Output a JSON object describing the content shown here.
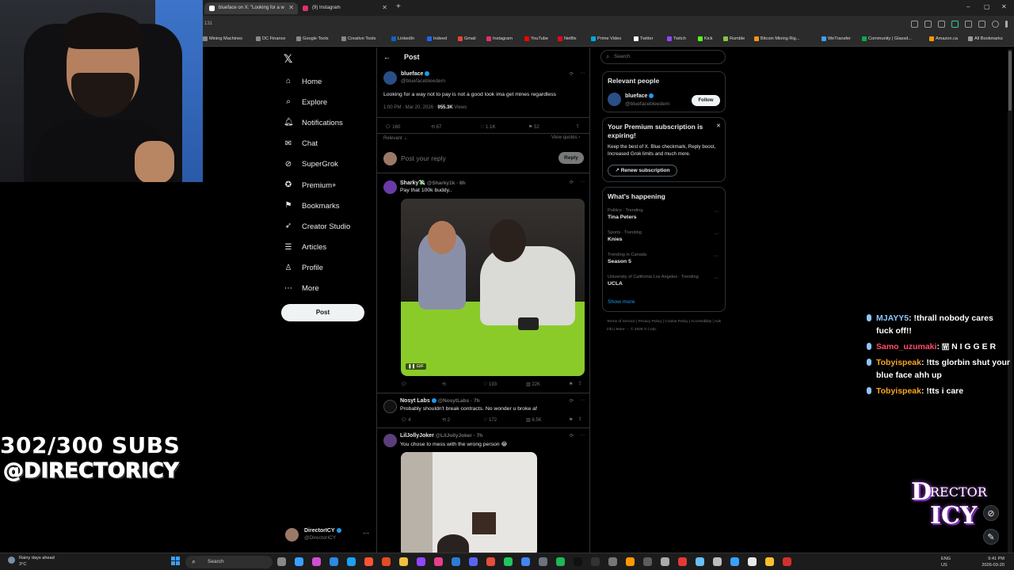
{
  "browser": {
    "tabs": [
      {
        "label": "blueface on X: \"Looking for a w",
        "color": "#ffffff",
        "active": true
      },
      {
        "label": "(9) Instagram",
        "color": "#e1306c",
        "active": false
      }
    ],
    "new_tab": "+",
    "window_controls": [
      "–",
      "▢",
      "✕"
    ],
    "address_fragment": "131",
    "bookmarks": [
      {
        "label": "Mining Machines",
        "color": "#888"
      },
      {
        "label": "DC Finance",
        "color": "#888"
      },
      {
        "label": "Google Tools",
        "color": "#888"
      },
      {
        "label": "Creative Tools",
        "color": "#888"
      },
      {
        "label": "LinkedIn",
        "color": "#0a66c2"
      },
      {
        "label": "Indeed",
        "color": "#2164f3"
      },
      {
        "label": "Gmail",
        "color": "#ea4335"
      },
      {
        "label": "Instagram",
        "color": "#e1306c"
      },
      {
        "label": "YouTube",
        "color": "#ff0000"
      },
      {
        "label": "Netflix",
        "color": "#e50914"
      },
      {
        "label": "Prime Video",
        "color": "#00a8e1"
      },
      {
        "label": "Twitter",
        "color": "#ffffff"
      },
      {
        "label": "Twitch",
        "color": "#9146ff"
      },
      {
        "label": "Kick",
        "color": "#53fc18"
      },
      {
        "label": "Rumble",
        "color": "#85c742"
      },
      {
        "label": "Bitcoin Mining Rig...",
        "color": "#f7931a"
      },
      {
        "label": "WeTransfer",
        "color": "#409fff"
      },
      {
        "label": "Community | Glassd...",
        "color": "#0caa41"
      },
      {
        "label": "Amazon.ca",
        "color": "#ff9900"
      }
    ],
    "all_bookmarks": "All Bookmarks"
  },
  "overlay": {
    "subs": "302/300 SUBS",
    "handle": "@DIRECTORICY",
    "logo_text": "DIRECTOR ICY",
    "chat": [
      {
        "user": "MJAYY5",
        "user_color": "#8ec5ff",
        "message": ": !thrall nobody cares fuck off!!"
      },
      {
        "user": "Samo_uzumaki",
        "user_color": "#ff4d6d",
        "message": ": 🇼 N I G G E R"
      },
      {
        "user": "Tobyispeak",
        "user_color": "#f6a623",
        "message": ": !tts glorbin shut your blue face ahh up"
      },
      {
        "user": "Tobyispeak",
        "user_color": "#f6a623",
        "message": ": !tts i care"
      }
    ]
  },
  "nav": {
    "logo": "𝕏",
    "items": [
      {
        "label": "Home",
        "icon": "⌂"
      },
      {
        "label": "Explore",
        "icon": "⌕"
      },
      {
        "label": "Notifications",
        "icon": "🔔︎"
      },
      {
        "label": "Chat",
        "icon": "✉"
      },
      {
        "label": "SuperGrok",
        "icon": "⊘"
      },
      {
        "label": "Premium+",
        "icon": "✪"
      },
      {
        "label": "Bookmarks",
        "icon": "⚑"
      },
      {
        "label": "Creator Studio",
        "icon": "➶"
      },
      {
        "label": "Articles",
        "icon": "☰"
      },
      {
        "label": "Profile",
        "icon": "♙"
      },
      {
        "label": "More",
        "icon": "⋯"
      }
    ],
    "post_button": "Post",
    "account": {
      "name": "DirectorICY",
      "handle": "@DirectorICY",
      "more": "···"
    }
  },
  "main": {
    "back": "←",
    "title": "Post",
    "post": {
      "name": "blueface",
      "handle": "@bluefacebleedem",
      "text": "Looking for a way not to pay is not a good look ima get mines regardless",
      "time": "1:00 PM · Mar 20, 2026 · ",
      "views_count": "955.3K",
      "views_label": " Views",
      "replies": "160",
      "reposts": "67",
      "likes": "1.1K",
      "bookmarks": "52",
      "sort": "Relevant ⌄",
      "view_quotes": "View quotes ›"
    },
    "composer": {
      "placeholder": "Post your reply",
      "button": "Reply"
    },
    "replies": [
      {
        "name": "Sharky💸",
        "handle": "@Sharky1k · 8h",
        "text": "Pay that 100k buddy..",
        "gif": "GIF",
        "counts": {
          "reply": "",
          "repost": "",
          "like": "193",
          "views": "22K"
        }
      },
      {
        "name": "Nosyt Labs",
        "handle": "@NosytLabs · 7h",
        "text": "Probably shouldn't break contracts. No wonder u broke af",
        "counts": {
          "reply": "4",
          "repost": "2",
          "like": "172",
          "views": "6.5K"
        }
      },
      {
        "name": "LilJollyJoker",
        "handle": "@LilJollyJoker · 7h",
        "text": "You chose to mess with the wrong person 😂"
      }
    ]
  },
  "right": {
    "search_placeholder": "Search",
    "relevant": {
      "title": "Relevant people",
      "name": "blueface",
      "handle": "@bluefacebleedem",
      "follow": "Follow"
    },
    "premium": {
      "title": "Your Premium subscription is expiring!",
      "body": "Keep the best of X. Blue checkmark, Reply boost, Increased Grok limits and much more.",
      "button": "↗ Renew subscription",
      "close": "✕"
    },
    "happening": {
      "title": "What's happening",
      "trends": [
        {
          "context": "Politics · Trending",
          "name": "Tina Peters"
        },
        {
          "context": "Sports · Trending",
          "name": "Knies"
        },
        {
          "context": "Trending in Canada",
          "name": "Season 5"
        },
        {
          "context": "University of California Los Angeles · Trending",
          "name": "UCLA"
        }
      ],
      "show_more": "Show more"
    },
    "footer": "Terms of Service  |  Privacy Policy  |  Cookie Policy  |  Accessibility  |  Ads info  |  More ···  © 2026 X Corp."
  },
  "taskbar": {
    "weather_title": "Rainy days ahead",
    "weather_temp": "3°C",
    "search": "Search",
    "lang": "ENG",
    "region": "US",
    "time": "9:41 PM",
    "date": "2026-03-20"
  }
}
